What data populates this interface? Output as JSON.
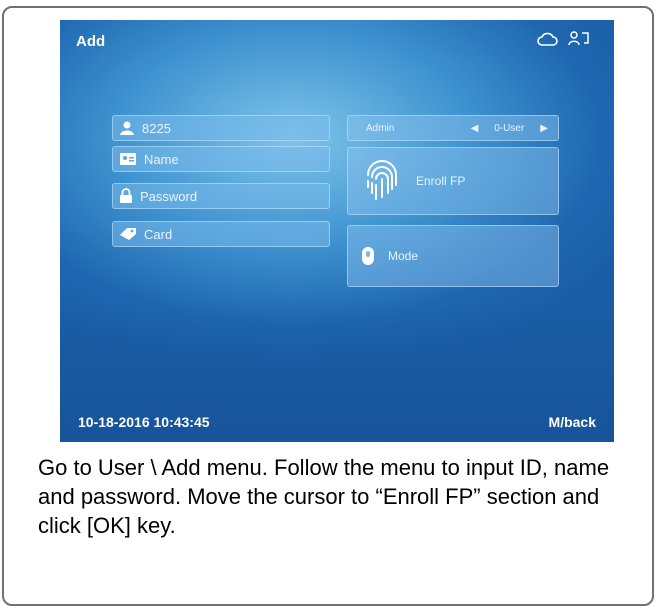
{
  "screen": {
    "title": "Add",
    "icons": [
      "cloud-icon",
      "user-switch-icon"
    ],
    "fields": {
      "id": "8225",
      "name": "Name",
      "password": "Password",
      "card": "Card"
    },
    "role": {
      "left_label": "Admin",
      "right_label": "0-User"
    },
    "enroll_label": "Enroll FP",
    "mode_label": "Mode",
    "datetime": "10-18-2016 10:43:45",
    "back_label": "M/back"
  },
  "caption": "Go to User \\ Add menu. Follow the menu to input ID, name and password. Move the cursor to “Enroll FP” section and click [OK] key."
}
